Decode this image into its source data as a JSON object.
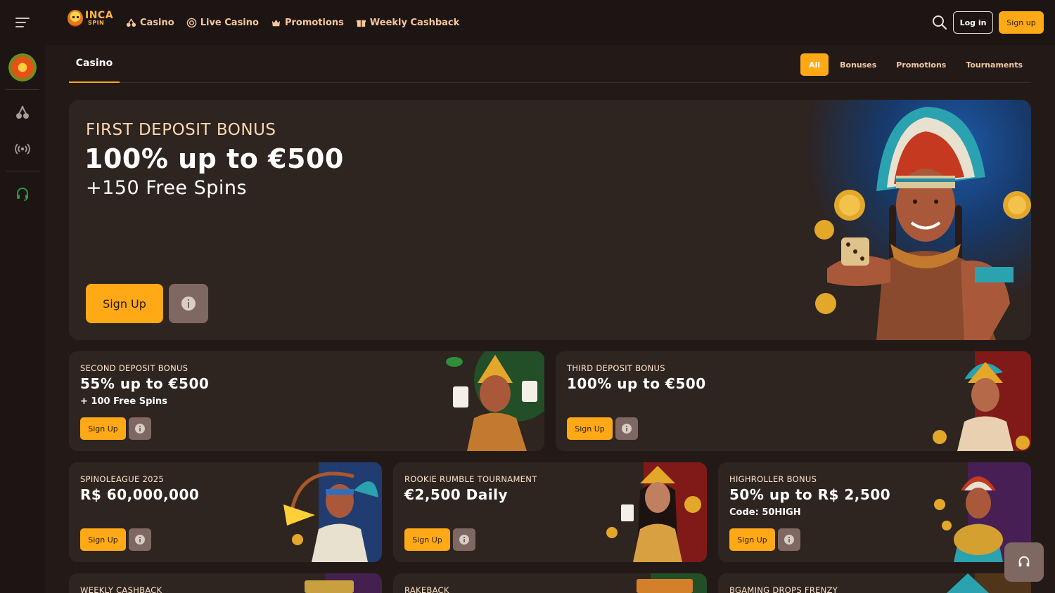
{
  "header": {
    "logo_line1": "INCA",
    "logo_line2": "SPIN",
    "nav": [
      {
        "label": "Casino",
        "icon": "cherry-icon"
      },
      {
        "label": "Live Casino",
        "icon": "live-icon"
      },
      {
        "label": "Promotions",
        "icon": "crown-icon"
      },
      {
        "label": "Weekly Cashback",
        "icon": "gift-icon"
      }
    ],
    "login_label": "Log in",
    "signup_label": "Sign up"
  },
  "sidebar": {
    "icons": [
      "avatar-icon",
      "cherry-icon",
      "broadcast-icon",
      "headset-icon"
    ]
  },
  "tabs": {
    "active": "Casino",
    "filters": [
      "All",
      "Bonuses",
      "Promotions",
      "Tournaments"
    ],
    "active_filter": "All"
  },
  "hero": {
    "eyebrow": "FIRST DEPOSIT BONUS",
    "title": "100% up to €500",
    "subtitle": "+150 Free Spins",
    "cta": "Sign Up"
  },
  "cards": [
    {
      "eyebrow": "SECOND DEPOSIT BONUS",
      "title": "55% up to €500",
      "sub": "+ 100 Free Spins",
      "cta": "Sign Up"
    },
    {
      "eyebrow": "THIRD DEPOSIT BONUS",
      "title": "100% up to €500",
      "sub": "",
      "cta": "Sign Up"
    },
    {
      "eyebrow": "SPINOLEAGUE 2025",
      "title": "R$ 60,000,000",
      "sub": "",
      "cta": "Sign Up"
    },
    {
      "eyebrow": "ROOKIE RUMBLE TOURNAMENT",
      "title": "€2,500 Daily",
      "sub": "",
      "cta": "Sign Up"
    },
    {
      "eyebrow": "HIGHROLLER BONUS",
      "title": "50% up to R$ 2,500",
      "sub": "Code: 50HIGH",
      "cta": "Sign Up"
    },
    {
      "eyebrow": "WEEKLY CASHBACK",
      "title": "",
      "sub": "",
      "cta": ""
    },
    {
      "eyebrow": "RAKEBACK",
      "title": "",
      "sub": "",
      "cta": ""
    },
    {
      "eyebrow": "BGAMING DROPS FRENZY",
      "title": "",
      "sub": "",
      "cta": ""
    }
  ],
  "colors": {
    "accent": "#ffa916",
    "background": "#231a17",
    "card": "#2e2420",
    "info": "#7e6861"
  }
}
